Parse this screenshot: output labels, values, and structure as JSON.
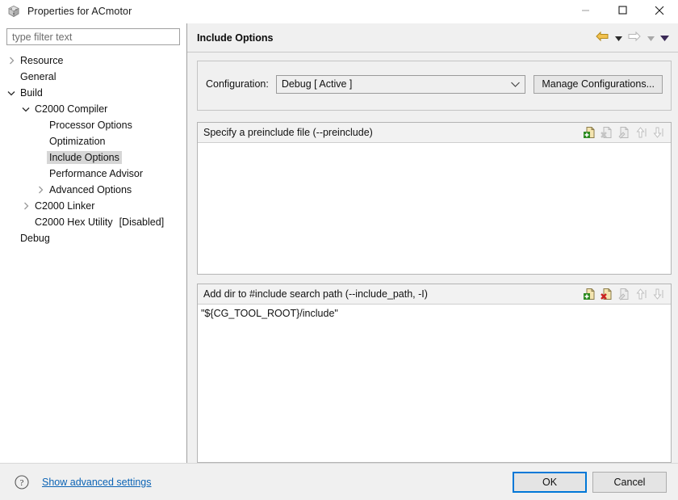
{
  "window": {
    "title": "Properties for ACmotor",
    "icon": "cube-icon",
    "controls": {
      "minimize": "minimize-icon",
      "maximize": "maximize-icon",
      "close": "close-icon"
    }
  },
  "sidebar": {
    "filter": {
      "value": "",
      "placeholder": "type filter text"
    },
    "items": [
      {
        "label": "Resource",
        "indent": 0,
        "twisty": "collapsed",
        "selected": false,
        "suffix": ""
      },
      {
        "label": "General",
        "indent": 0,
        "twisty": "none",
        "selected": false,
        "suffix": ""
      },
      {
        "label": "Build",
        "indent": 0,
        "twisty": "expanded",
        "selected": false,
        "suffix": ""
      },
      {
        "label": "C2000 Compiler",
        "indent": 1,
        "twisty": "expanded",
        "selected": false,
        "suffix": ""
      },
      {
        "label": "Processor Options",
        "indent": 2,
        "twisty": "none",
        "selected": false,
        "suffix": ""
      },
      {
        "label": "Optimization",
        "indent": 2,
        "twisty": "none",
        "selected": false,
        "suffix": ""
      },
      {
        "label": "Include Options",
        "indent": 2,
        "twisty": "none",
        "selected": true,
        "suffix": ""
      },
      {
        "label": "Performance Advisor",
        "indent": 2,
        "twisty": "none",
        "selected": false,
        "suffix": ""
      },
      {
        "label": "Advanced Options",
        "indent": 2,
        "twisty": "collapsed",
        "selected": false,
        "suffix": ""
      },
      {
        "label": "C2000 Linker",
        "indent": 1,
        "twisty": "collapsed",
        "selected": false,
        "suffix": ""
      },
      {
        "label": "C2000 Hex Utility",
        "indent": 1,
        "twisty": "none",
        "selected": false,
        "suffix": "[Disabled]"
      },
      {
        "label": "Debug",
        "indent": 0,
        "twisty": "none",
        "selected": false,
        "suffix": ""
      }
    ]
  },
  "header": {
    "title": "Include Options",
    "back_icon": "back-arrow-icon",
    "back_menu_icon": "chevron-down-icon",
    "forward_icon": "forward-arrow-icon",
    "forward_menu_icon": "chevron-down-icon",
    "menu_icon": "chevron-down-icon"
  },
  "configuration": {
    "label": "Configuration:",
    "selected": "Debug  [ Active ]",
    "options": [
      "Debug  [ Active ]"
    ],
    "manage_button": "Manage Configurations..."
  },
  "groups": [
    {
      "title": "Specify a preinclude file (--preinclude)",
      "items": [],
      "tools": [
        {
          "name": "add-icon",
          "enabled": true
        },
        {
          "name": "delete-icon",
          "enabled": false
        },
        {
          "name": "edit-icon",
          "enabled": false
        },
        {
          "name": "move-up-icon",
          "enabled": false
        },
        {
          "name": "move-down-icon",
          "enabled": false
        }
      ]
    },
    {
      "title": "Add dir to #include search path (--include_path, -I)",
      "items": [
        "\"${CG_TOOL_ROOT}/include\""
      ],
      "tools": [
        {
          "name": "add-icon",
          "enabled": true
        },
        {
          "name": "delete-icon",
          "enabled": true
        },
        {
          "name": "edit-icon",
          "enabled": false
        },
        {
          "name": "move-up-icon",
          "enabled": false
        },
        {
          "name": "move-down-icon",
          "enabled": false
        }
      ]
    }
  ],
  "footer": {
    "help_icon": "help-icon",
    "advanced_link": "Show advanced settings",
    "ok_label": "OK",
    "cancel_label": "Cancel"
  },
  "colors": {
    "accent": "#0078d7",
    "link": "#0b63b5",
    "back_arrow": "#e8b23a",
    "add_green": "#2e8b22",
    "delete_red": "#cc2222",
    "panel_bg": "#f0f0f0",
    "selection": "#d6d6d6"
  }
}
